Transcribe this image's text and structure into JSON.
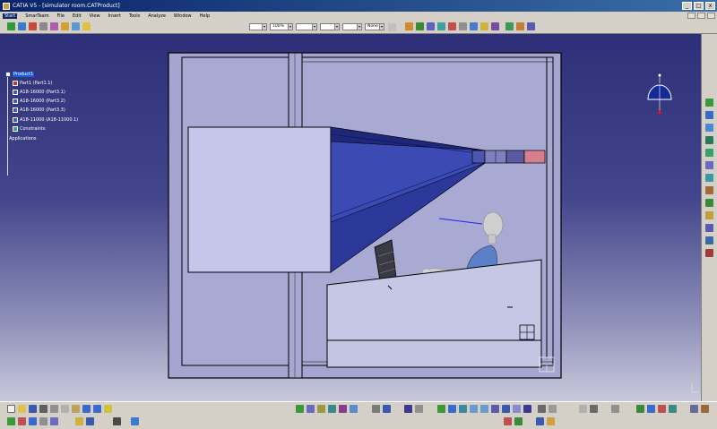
{
  "window": {
    "title": "CATIA V5 - [simulator room.CATProduct]",
    "controls": [
      "_",
      "□",
      "x"
    ]
  },
  "menu": {
    "items": [
      "Start",
      "SmarTeam",
      "File",
      "Edit",
      "View",
      "Insert",
      "Tools",
      "Analyze",
      "Window",
      "Help"
    ],
    "active_index": 0
  },
  "toolbar": {
    "zoom_value": "100%",
    "line_type_value": "None"
  },
  "tree": {
    "nodes": [
      {
        "label": "Product1",
        "selected": true
      },
      {
        "label": "Part1 (Part1.1)"
      },
      {
        "label": "A18-16000 (Part3.1)"
      },
      {
        "label": "A18-16000 (Part3.2)"
      },
      {
        "label": "A18-16000 (Part3.3)"
      },
      {
        "label": "A18-11000 (A18-11000.1)"
      },
      {
        "label": "Constraints"
      },
      {
        "label": "Applications"
      }
    ]
  },
  "colors": {
    "viewport_top": "#2d2f78",
    "viewport_bottom": "#c9c9dc",
    "room_fill": "#a4a5d0",
    "screen_fill": "#c5c6ea",
    "projection_dark": "#252d8e",
    "projection_mid": "#3c4ab4",
    "selection": "#1c5bd6",
    "ui_gray": "#d4d0c8"
  },
  "icons": {
    "compass": "compass-icon",
    "tree_root": "product-icon",
    "tree_part": "part-icon",
    "tree_constraints": "constraints-icon"
  }
}
